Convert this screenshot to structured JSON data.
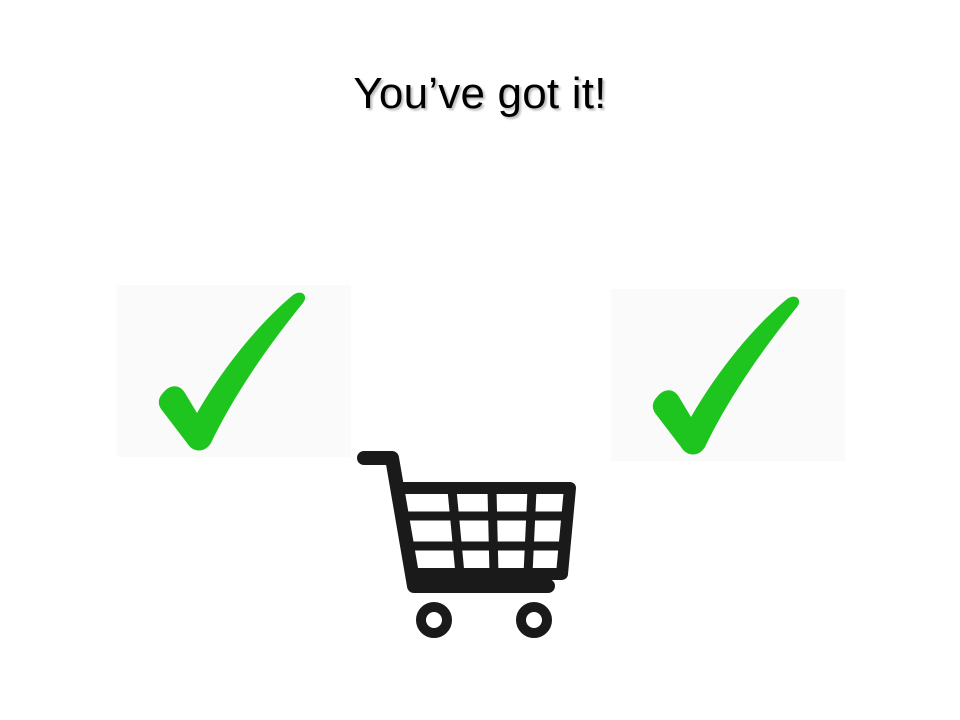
{
  "slide": {
    "title": "You’ve got it!"
  },
  "icons": {
    "left_check": "check-mark-icon",
    "right_check": "check-mark-icon",
    "cart": "shopping-cart-icon"
  },
  "colors": {
    "check": "#1ec51e",
    "cart": "#1a1a1a",
    "background": "#ffffff"
  }
}
